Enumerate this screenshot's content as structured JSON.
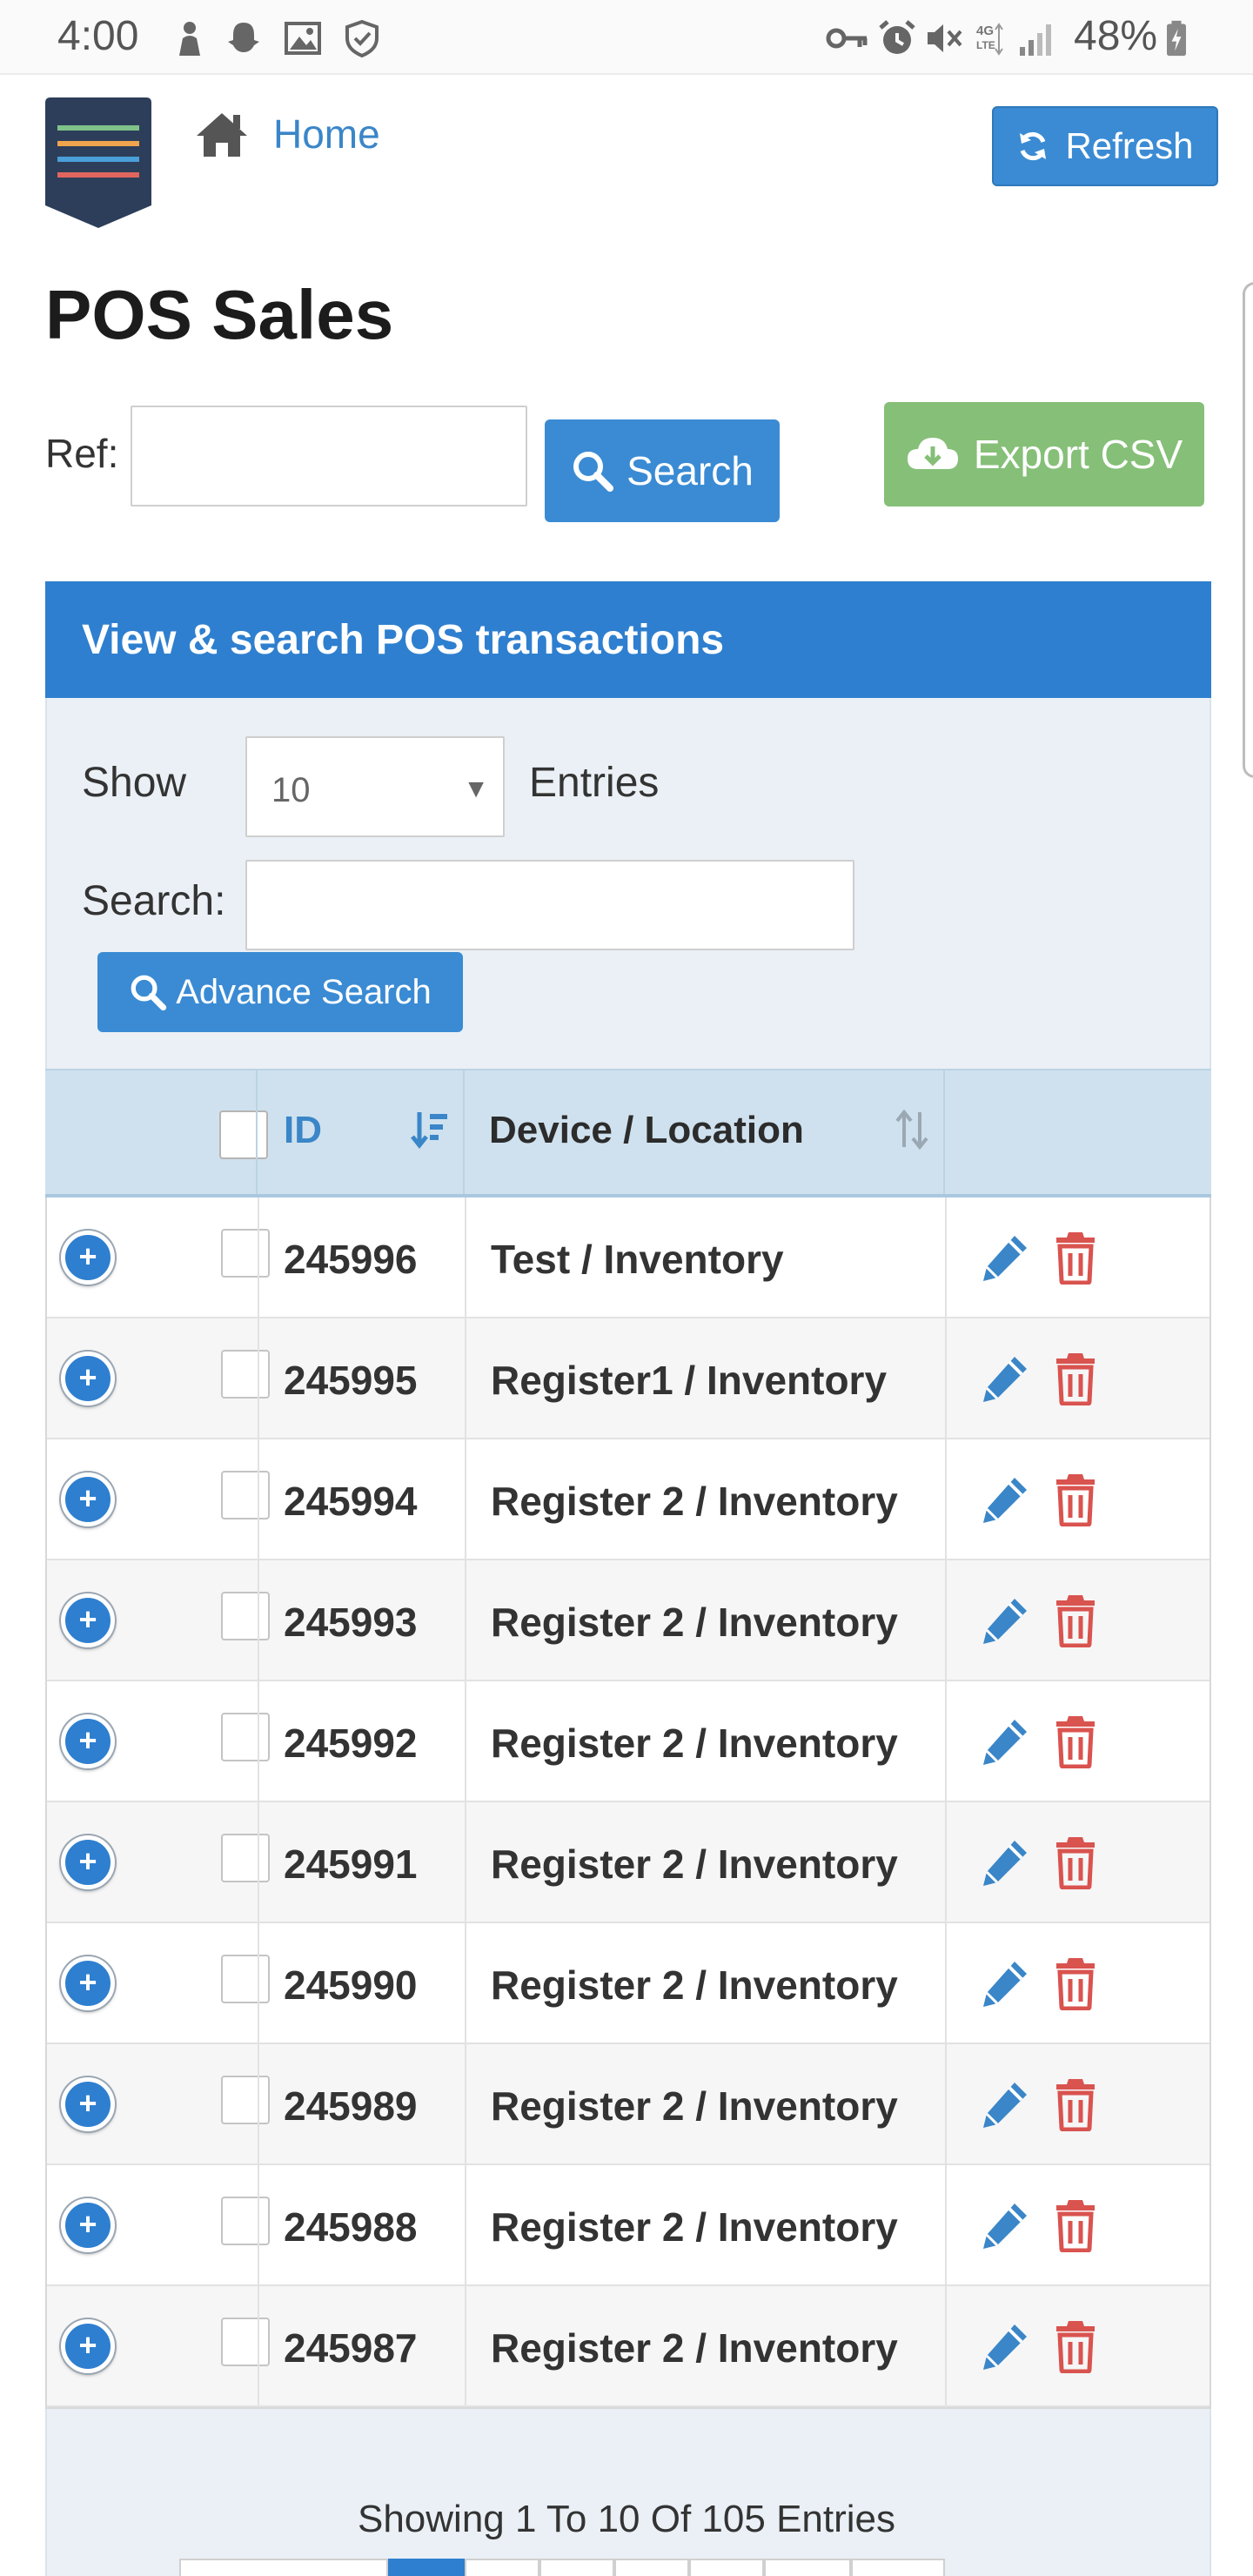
{
  "status_bar": {
    "time": "4:00",
    "battery": "48%",
    "icons": [
      "person-icon",
      "snapchat-icon",
      "gallery-icon",
      "shield-icon",
      "key-icon",
      "alarm-icon",
      "mute-icon",
      "4g-lte-icon",
      "signal-icon",
      "battery-charging-icon"
    ]
  },
  "header": {
    "home_label": "Home",
    "refresh_label": "Refresh",
    "logo_colors": [
      "#7fc38a",
      "#f0a44d",
      "#4a9fd8",
      "#e0665d"
    ]
  },
  "page": {
    "title": "POS Sales",
    "ref_label": "Ref:",
    "ref_value": "",
    "search_label": "Search",
    "export_label": "Export CSV"
  },
  "panel": {
    "title": "View & search POS transactions",
    "show_label": "Show",
    "show_value": "10",
    "entries_label": "Entries",
    "search_label": "Search:",
    "search_value": "",
    "advance_search_label": "Advance Search"
  },
  "table": {
    "columns": [
      "ID",
      "Device / Location"
    ],
    "rows": [
      {
        "id": "245996",
        "device": "Test / Inventory"
      },
      {
        "id": "245995",
        "device": "Register1 / Inventory"
      },
      {
        "id": "245994",
        "device": "Register 2 / Inventory"
      },
      {
        "id": "245993",
        "device": "Register 2 / Inventory"
      },
      {
        "id": "245992",
        "device": "Register 2 / Inventory"
      },
      {
        "id": "245991",
        "device": "Register 2 / Inventory"
      },
      {
        "id": "245990",
        "device": "Register 2 / Inventory"
      },
      {
        "id": "245989",
        "device": "Register 2 / Inventory"
      },
      {
        "id": "245988",
        "device": "Register 2 / Inventory"
      },
      {
        "id": "245987",
        "device": "Register 2 / Inventory"
      }
    ]
  },
  "footer": {
    "info": "Showing 1 To 10 Of 105 Entries",
    "active_page_color": "#2e7fcf"
  },
  "colors": {
    "primary": "#3a8bd4",
    "panel_header": "#2e7fcf",
    "export": "#86bf78",
    "delete": "#d9534f"
  }
}
